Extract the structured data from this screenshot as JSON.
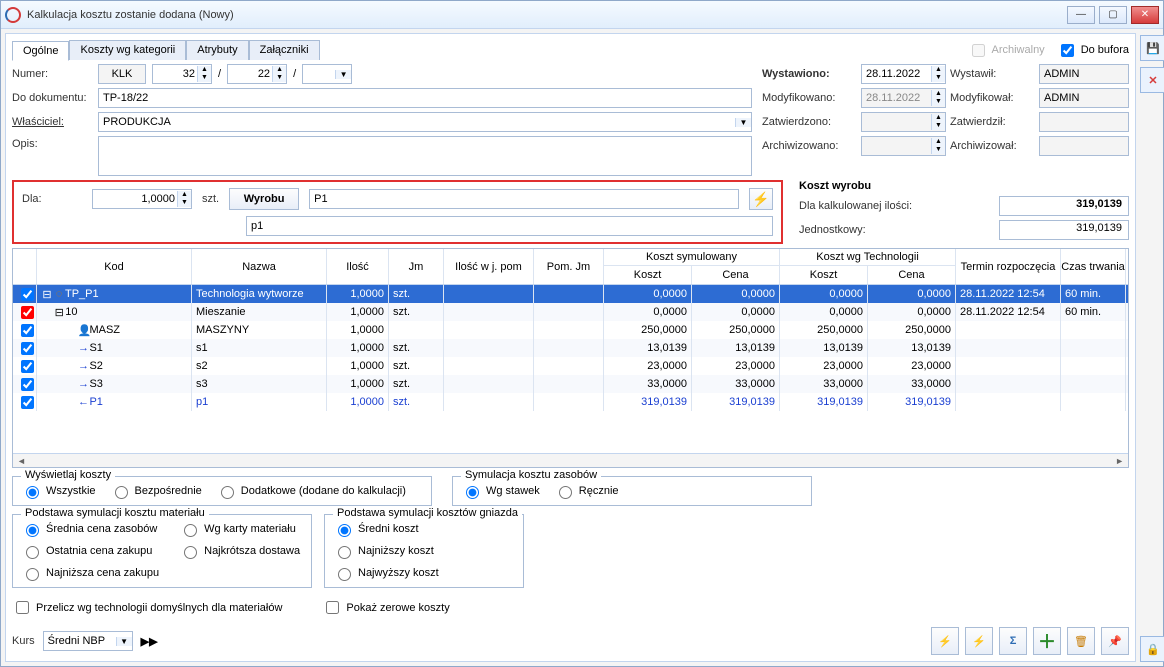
{
  "window_title": "Kalkulacja kosztu zostanie dodana  (Nowy)",
  "tabs": [
    "Ogólne",
    "Koszty wg kategorii",
    "Atrybuty",
    "Załączniki"
  ],
  "archival": "Archiwalny",
  "to_buffer": "Do bufora",
  "labels": {
    "numer": "Numer:",
    "kod_numer": "KLK",
    "numer_a": "32",
    "numer_b": "22",
    "do_dok": "Do dokumentu:",
    "do_dok_val": "TP-18/22",
    "owner": "Właściciel:",
    "owner_val": "PRODUKCJA",
    "opis": "Opis:",
    "wystawiono": "Wystawiono:",
    "wystawil": "Wystawił:",
    "wystawiono_val": "28.11.2022",
    "wystawil_val": "ADMIN",
    "modyfikowano": "Modyfikowano:",
    "modyfikowal": "Modyfikował:",
    "modyfikowano_val": "28.11.2022",
    "modyfikowal_val": "ADMIN",
    "zatwierdzono": "Zatwierdzono:",
    "zatwierdzil": "Zatwierdził:",
    "archiwizowano": "Archiwizowano:",
    "archiwizowal": "Archiwizował:"
  },
  "dla_section": {
    "dla": "Dla:",
    "qty": "1,0000",
    "unit": "szt.",
    "wyrobu": "Wyrobu",
    "product": "P1",
    "product_desc": "p1"
  },
  "koszt_wyrobu": {
    "title": "Koszt wyrobu",
    "row1_label": "Dla kalkulowanej ilości:",
    "row1_val": "319,0139",
    "row2_label": "Jednostkowy:",
    "row2_val": "319,0139"
  },
  "columns": {
    "kod": "Kod",
    "nazwa": "Nazwa",
    "ilosc": "Ilość",
    "jm": "Jm",
    "ilosc_pom": "Ilość w j. pom",
    "pom_jm": "Pom. Jm",
    "ks_group": "Koszt symulowany",
    "kt_group": "Koszt wg Technologii",
    "koszt": "Koszt",
    "cena": "Cena",
    "termin": "Termin rozpoczęcia",
    "czas": "Czas trwania"
  },
  "rows": [
    {
      "sel": true,
      "chk": true,
      "indent": 0,
      "expand": "-",
      "ico": "circle",
      "kod": "TP_P1",
      "nazwa": "Technologia wytworze",
      "il": "1,0000",
      "jm": "szt.",
      "ks": "0,0000",
      "cs": "0,0000",
      "kt": "0,0000",
      "ct": "0,0000",
      "term": "28.11.2022 12:54",
      "dur": "60 min."
    },
    {
      "chk": true,
      "redchk": true,
      "indent": 1,
      "expand": "-",
      "kod": "10",
      "nazwa": "Mieszanie",
      "il": "1,0000",
      "jm": "szt.",
      "ks": "0,0000",
      "cs": "0,0000",
      "kt": "0,0000",
      "ct": "0,0000",
      "term": "28.11.2022 12:54",
      "dur": "60 min."
    },
    {
      "chk": true,
      "indent": 2,
      "ico": "person",
      "kod": "MASZ",
      "nazwa": "MASZYNY",
      "il": "1,0000",
      "jm": "",
      "ks": "250,0000",
      "cs": "250,0000",
      "kt": "250,0000",
      "ct": "250,0000"
    },
    {
      "chk": true,
      "indent": 2,
      "ico": "arrow-r",
      "kod": "S1",
      "nazwa": "s1",
      "il": "1,0000",
      "jm": "szt.",
      "ks": "13,0139",
      "cs": "13,0139",
      "kt": "13,0139",
      "ct": "13,0139"
    },
    {
      "chk": true,
      "indent": 2,
      "ico": "arrow-r",
      "kod": "S2",
      "nazwa": "s2",
      "il": "1,0000",
      "jm": "szt.",
      "ks": "23,0000",
      "cs": "23,0000",
      "kt": "23,0000",
      "ct": "23,0000"
    },
    {
      "chk": true,
      "indent": 2,
      "ico": "arrow-r",
      "kod": "S3",
      "nazwa": "s3",
      "il": "1,0000",
      "jm": "szt.",
      "ks": "33,0000",
      "cs": "33,0000",
      "kt": "33,0000",
      "ct": "33,0000"
    },
    {
      "chk": true,
      "blue": true,
      "indent": 2,
      "ico": "arrow-l",
      "kod": "P1",
      "nazwa": "p1",
      "il": "1,0000",
      "jm": "szt.",
      "ks": "319,0139",
      "cs": "319,0139",
      "kt": "319,0139",
      "ct": "319,0139"
    }
  ],
  "wyswietlaj": {
    "legend": "Wyświetlaj koszty",
    "opts": [
      "Wszystkie",
      "Bezpośrednie",
      "Dodatkowe (dodane do kalkulacji)"
    ]
  },
  "symulacja": {
    "legend": "Symulacja kosztu zasobów",
    "opts": [
      "Wg stawek",
      "Ręcznie"
    ]
  },
  "podstawa_mat": {
    "legend": "Podstawa symulacji kosztu materiału",
    "left": [
      "Średnia cena zasobów",
      "Ostatnia cena zakupu",
      "Najniższa cena zakupu"
    ],
    "right": [
      "Wg karty materiału",
      "Najkrótsza dostawa"
    ]
  },
  "podstawa_gniazda": {
    "legend": "Podstawa symulacji kosztów gniazda",
    "opts": [
      "Średni koszt",
      "Najniższy koszt",
      "Najwyższy koszt"
    ]
  },
  "bottom_checks": {
    "przelicz": "Przelicz wg technologii domyślnych dla materiałów",
    "pokaz": "Pokaż zerowe koszty"
  },
  "kurs": {
    "label": "Kurs",
    "val": "Średni NBP"
  }
}
